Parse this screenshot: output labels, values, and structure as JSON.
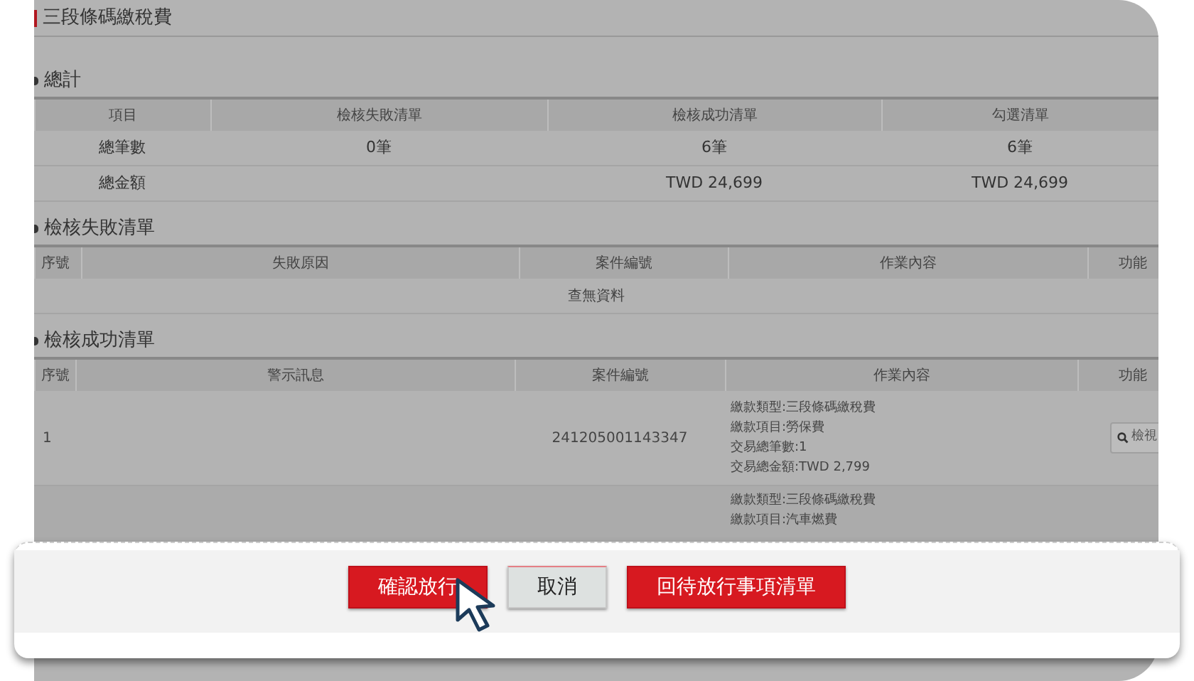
{
  "page_title": "三段條碼繳稅費",
  "summary": {
    "title": "總計",
    "columns": [
      "項目",
      "檢核失敗清單",
      "檢核成功清單",
      "勾選清單"
    ],
    "rows": [
      [
        "總筆數",
        "0筆",
        "6筆",
        "6筆"
      ],
      [
        "總金額",
        "",
        "TWD 24,699",
        "TWD 24,699"
      ]
    ]
  },
  "failed": {
    "title": "檢核失敗清單",
    "columns": [
      "序號",
      "失敗原因",
      "案件編號",
      "作業內容",
      "功能"
    ],
    "empty_text": "查無資料"
  },
  "passed": {
    "title": "檢核成功清單",
    "columns": [
      "序號",
      "警示訊息",
      "案件編號",
      "作業內容",
      "功能"
    ],
    "rows": [
      {
        "index": "1",
        "case_no": "241205001143347",
        "details": [
          "繳款類型:三段條碼繳稅費",
          "繳款項目:勞保費",
          "交易總筆數:1",
          "交易總金額:TWD 2,799"
        ],
        "action": "檢視"
      },
      {
        "details": [
          "繳款類型:三段條碼繳稅費",
          "繳款項目:汽車燃費"
        ]
      }
    ]
  },
  "footer_buttons": [
    {
      "label": "確認放行",
      "kind": "primary"
    },
    {
      "label": "取消",
      "kind": "secondary"
    },
    {
      "label": "回待放行事項清單",
      "kind": "primary"
    }
  ]
}
